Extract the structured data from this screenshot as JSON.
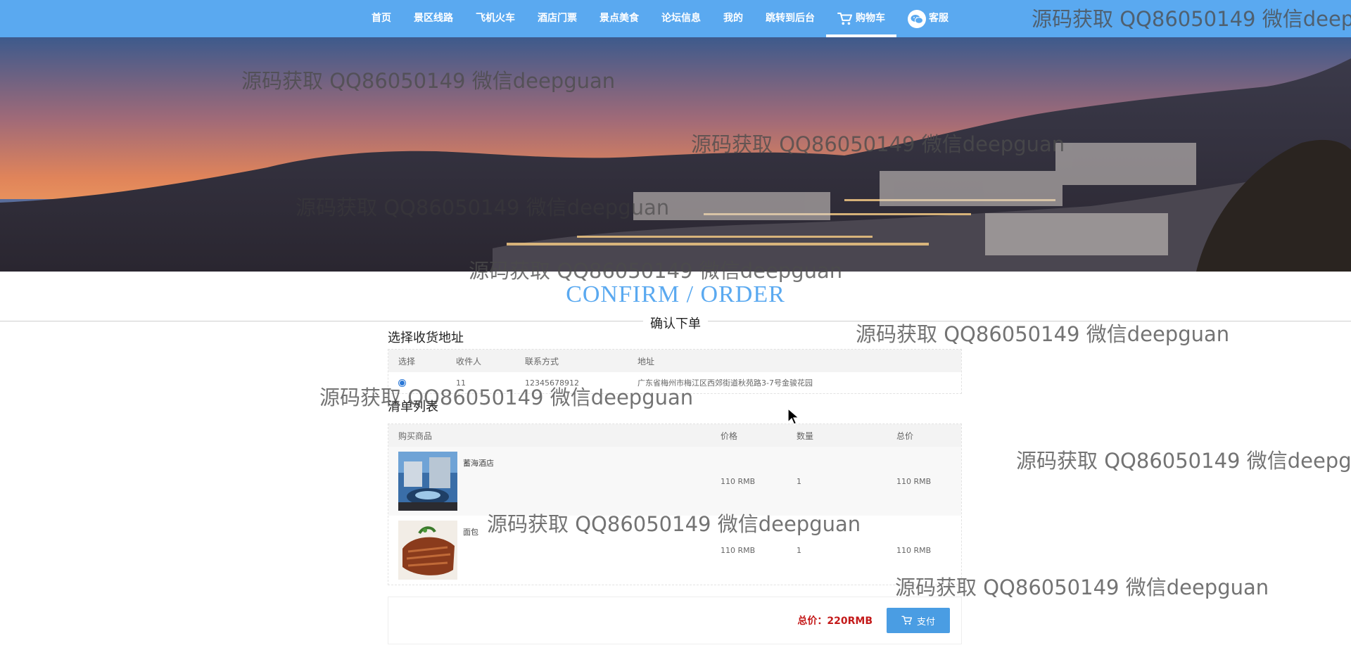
{
  "nav": {
    "items": [
      "首页",
      "景区线路",
      "飞机火车",
      "酒店门票",
      "景点美食",
      "论坛信息",
      "我的",
      "跳转到后台"
    ],
    "cart_label": "购物车",
    "service_label": "客服"
  },
  "page": {
    "title_en": "CONFIRM / ORDER",
    "title_cn": "确认下单"
  },
  "address": {
    "section_title": "选择收货地址",
    "headers": [
      "选择",
      "收件人",
      "联系方式",
      "地址"
    ],
    "rows": [
      {
        "selected": true,
        "recipient": "11",
        "phone": "12345678912",
        "address": "广东省梅州市梅江区西郊街道秋苑路3-7号金骏花园"
      }
    ]
  },
  "list": {
    "section_title": "清单列表",
    "headers": [
      "购买商品",
      "价格",
      "数量",
      "总价"
    ],
    "rows": [
      {
        "name": "蓄海酒店",
        "price": "110 RMB",
        "qty": "1",
        "total": "110 RMB",
        "image": "hotel-photo"
      },
      {
        "name": "面包",
        "price": "110 RMB",
        "qty": "1",
        "total": "110 RMB",
        "image": "food-photo"
      }
    ]
  },
  "summary": {
    "total_label": "总价：220RMB",
    "pay_label": "支付"
  },
  "watermark": "源码获取 QQ86050149 微信deepguan",
  "icons": {
    "cart": "cart-icon",
    "service": "wechat-icon",
    "pay": "cart-icon"
  },
  "colors": {
    "nav_bg": "#5aa9f0",
    "accent": "#5aa9f0",
    "total": "#c41a1a",
    "pay_button": "#4a9de3"
  }
}
